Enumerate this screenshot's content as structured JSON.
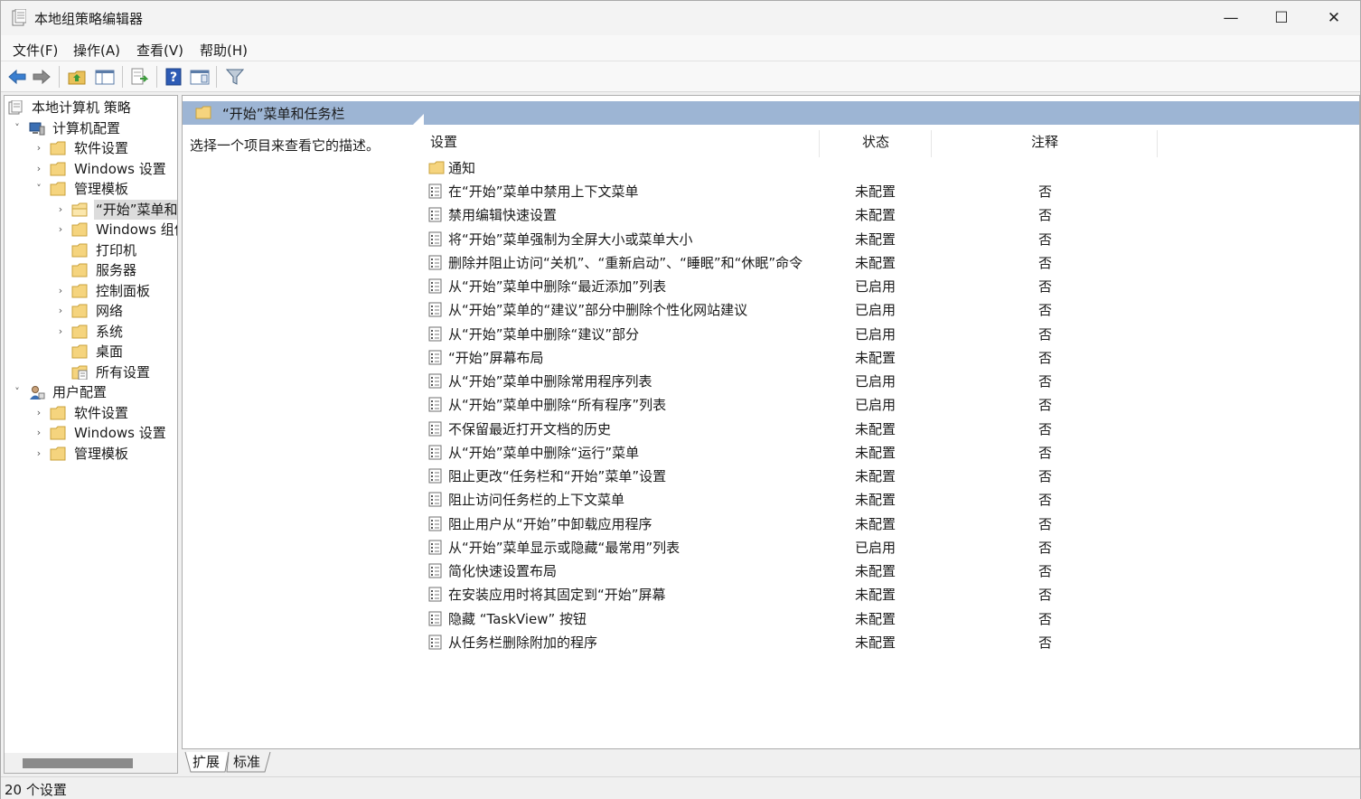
{
  "window": {
    "title": "本地组策略编辑器",
    "controls": {
      "minimize": "—",
      "maximize": "☐",
      "close": "✕"
    }
  },
  "menu": [
    "文件(F)",
    "操作(A)",
    "查看(V)",
    "帮助(H)"
  ],
  "toolbar": {
    "icons": [
      "back-arrow-icon",
      "forward-arrow-icon",
      "up-folder-icon",
      "show-hide-tree-icon",
      "export-list-icon",
      "help-icon",
      "properties-icon",
      "filter-icon"
    ]
  },
  "tree": {
    "items": [
      {
        "label": "本地计算机 策略",
        "arrow": "",
        "icon": "policy-doc-icon"
      },
      {
        "label": "计算机配置",
        "arrow": "˅",
        "icon": "computer-icon"
      },
      {
        "label": "软件设置",
        "arrow": "›",
        "icon": "folder-icon"
      },
      {
        "label": "Windows 设置",
        "arrow": "›",
        "icon": "folder-icon"
      },
      {
        "label": "管理模板",
        "arrow": "˅",
        "icon": "folder-icon"
      },
      {
        "label": "“开始”菜单和任务栏",
        "arrow": "›",
        "icon": "folder-open-icon"
      },
      {
        "label": "Windows 组件",
        "arrow": "›",
        "icon": "folder-icon"
      },
      {
        "label": "打印机",
        "arrow": "",
        "icon": "folder-icon"
      },
      {
        "label": "服务器",
        "arrow": "",
        "icon": "folder-icon"
      },
      {
        "label": "控制面板",
        "arrow": "›",
        "icon": "folder-icon"
      },
      {
        "label": "网络",
        "arrow": "›",
        "icon": "folder-icon"
      },
      {
        "label": "系统",
        "arrow": "›",
        "icon": "folder-icon"
      },
      {
        "label": "桌面",
        "arrow": "",
        "icon": "folder-icon"
      },
      {
        "label": "所有设置",
        "arrow": "",
        "icon": "all-settings-icon"
      },
      {
        "label": "用户配置",
        "arrow": "˅",
        "icon": "user-icon"
      },
      {
        "label": "软件设置",
        "arrow": "›",
        "icon": "folder-icon"
      },
      {
        "label": "Windows 设置",
        "arrow": "›",
        "icon": "folder-icon"
      },
      {
        "label": "管理模板",
        "arrow": "›",
        "icon": "folder-icon"
      }
    ]
  },
  "panel": {
    "header": "“开始”菜单和任务栏",
    "description": "选择一个项目来查看它的描述。",
    "columns": {
      "setting": "设置",
      "state": "状态",
      "note": "注释"
    },
    "folder_row": "通知",
    "rows": [
      {
        "name": "在“开始”菜单中禁用上下文菜单",
        "state": "未配置",
        "note": "否"
      },
      {
        "name": "禁用编辑快速设置",
        "state": "未配置",
        "note": "否"
      },
      {
        "name": "将“开始”菜单强制为全屏大小或菜单大小",
        "state": "未配置",
        "note": "否"
      },
      {
        "name": "删除并阻止访问“关机”、“重新启动”、“睡眠”和“休眠”命令",
        "state": "未配置",
        "note": "否"
      },
      {
        "name": "从“开始”菜单中删除“最近添加”列表",
        "state": "已启用",
        "note": "否"
      },
      {
        "name": "从“开始”菜单的“建议”部分中删除个性化网站建议",
        "state": "已启用",
        "note": "否"
      },
      {
        "name": "从“开始”菜单中删除“建议”部分",
        "state": "已启用",
        "note": "否"
      },
      {
        "name": "“开始”屏幕布局",
        "state": "未配置",
        "note": "否"
      },
      {
        "name": "从“开始”菜单中删除常用程序列表",
        "state": "已启用",
        "note": "否"
      },
      {
        "name": "从“开始”菜单中删除“所有程序”列表",
        "state": "已启用",
        "note": "否"
      },
      {
        "name": "不保留最近打开文档的历史",
        "state": "未配置",
        "note": "否"
      },
      {
        "name": "从“开始”菜单中删除“运行”菜单",
        "state": "未配置",
        "note": "否"
      },
      {
        "name": "阻止更改“任务栏和“开始”菜单”设置",
        "state": "未配置",
        "note": "否"
      },
      {
        "name": "阻止访问任务栏的上下文菜单",
        "state": "未配置",
        "note": "否"
      },
      {
        "name": "阻止用户从“开始”中卸载应用程序",
        "state": "未配置",
        "note": "否"
      },
      {
        "name": "从“开始”菜单显示或隐藏“最常用”列表",
        "state": "已启用",
        "note": "否"
      },
      {
        "name": "简化快速设置布局",
        "state": "未配置",
        "note": "否"
      },
      {
        "name": "在安装应用时将其固定到“开始”屏幕",
        "state": "未配置",
        "note": "否"
      },
      {
        "name": "隐藏 “TaskView” 按钮",
        "state": "未配置",
        "note": "否"
      },
      {
        "name": "从任务栏删除附加的程序",
        "state": "未配置",
        "note": "否"
      }
    ]
  },
  "tabs": [
    "扩展",
    "标准"
  ],
  "status": "20 个设置",
  "colors": {
    "header_bg": "#9db5d4",
    "selected_bg": "#dcdcdc",
    "folder": "#f0c65a"
  }
}
